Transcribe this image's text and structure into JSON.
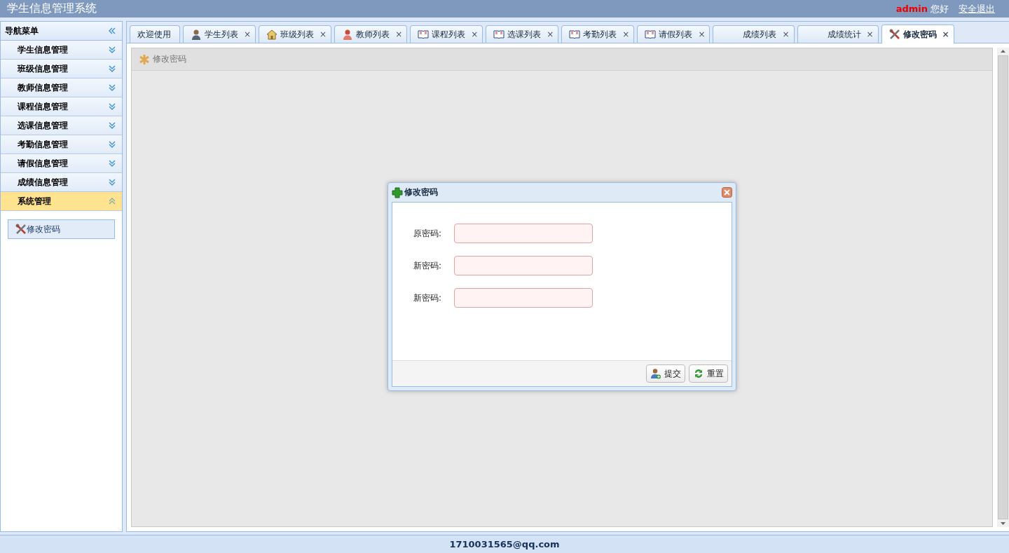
{
  "header": {
    "title": "学生信息管理系统",
    "user": "admin",
    "greeting": "您好",
    "logout": "安全退出"
  },
  "sidebar": {
    "title": "导航菜单",
    "items": [
      {
        "label": "学生信息管理",
        "expanded": false
      },
      {
        "label": "班级信息管理",
        "expanded": false
      },
      {
        "label": "教师信息管理",
        "expanded": false
      },
      {
        "label": "课程信息管理",
        "expanded": false
      },
      {
        "label": "选课信息管理",
        "expanded": false
      },
      {
        "label": "考勤信息管理",
        "expanded": false
      },
      {
        "label": "请假信息管理",
        "expanded": false
      },
      {
        "label": "成绩信息管理",
        "expanded": false
      },
      {
        "label": "系统管理",
        "expanded": true,
        "children": [
          {
            "label": "修改密码",
            "kind": "tools",
            "selected": true
          }
        ]
      }
    ]
  },
  "tabs": [
    {
      "label": "欢迎使用",
      "kind": "none",
      "closable": false,
      "selected": false
    },
    {
      "label": "学生列表",
      "kind": "user",
      "closable": true,
      "selected": false
    },
    {
      "label": "班级列表",
      "kind": "home",
      "closable": true,
      "selected": false
    },
    {
      "label": "教师列表",
      "kind": "teacher",
      "closable": true,
      "selected": false
    },
    {
      "label": "课程列表",
      "kind": "book",
      "closable": true,
      "selected": false
    },
    {
      "label": "选课列表",
      "kind": "book",
      "closable": true,
      "selected": false
    },
    {
      "label": "考勤列表",
      "kind": "book",
      "closable": true,
      "selected": false
    },
    {
      "label": "请假列表",
      "kind": "book",
      "closable": true,
      "selected": false
    },
    {
      "label": "成绩列表",
      "kind": "blank",
      "closable": true,
      "selected": false
    },
    {
      "label": "成绩统计",
      "kind": "blank",
      "closable": true,
      "selected": false
    },
    {
      "label": "修改密码",
      "kind": "tools",
      "closable": true,
      "selected": true
    }
  ],
  "close_glyph": "×",
  "panel": {
    "title": "修改密码"
  },
  "dialog": {
    "title": "修改密码",
    "fields": [
      {
        "label": "原密码:"
      },
      {
        "label": "新密码:"
      },
      {
        "label": "新密码:"
      }
    ],
    "buttons": [
      {
        "label": "提交",
        "kind": "user-add"
      },
      {
        "label": "重置",
        "kind": "refresh"
      }
    ]
  },
  "footer": {
    "text": "1710031565@qq.com"
  }
}
